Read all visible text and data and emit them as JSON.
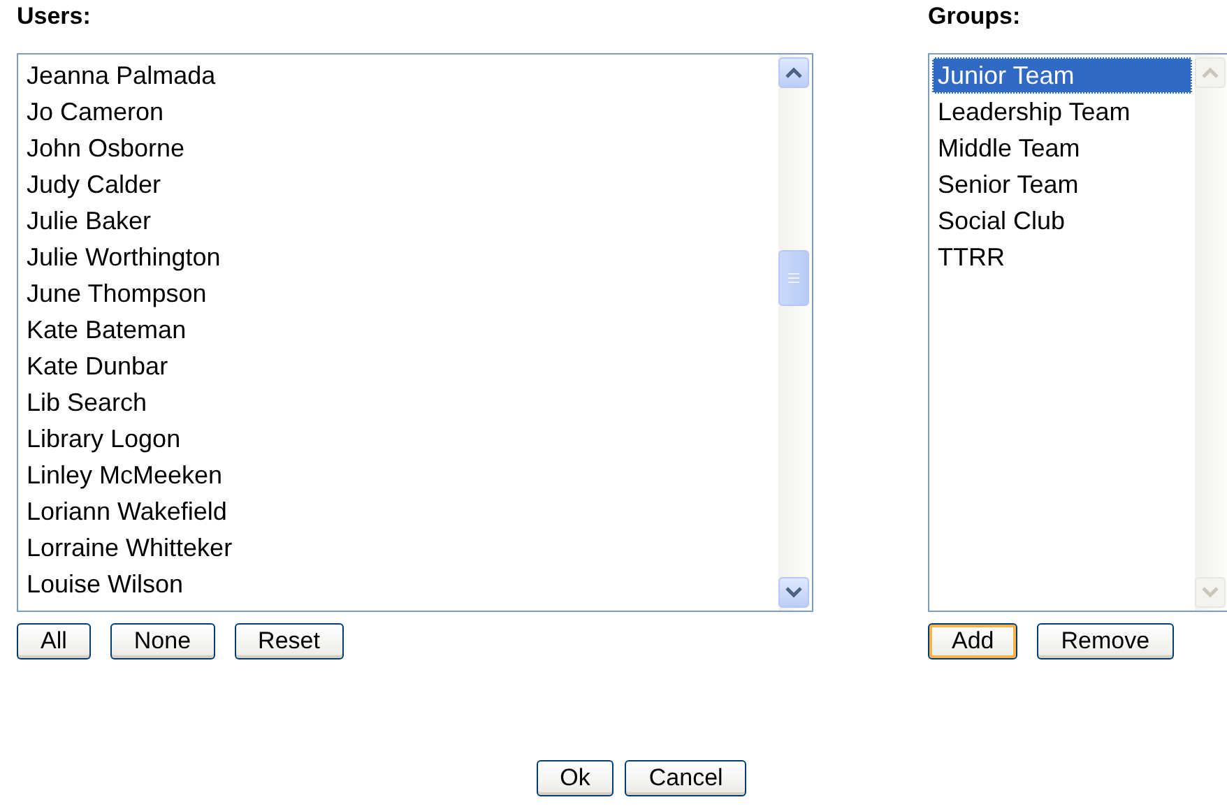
{
  "users": {
    "label": "Users:",
    "scrollbar_disabled": false,
    "items": [
      {
        "name": "Jeanna Palmada",
        "selected": false
      },
      {
        "name": "Jo Cameron",
        "selected": false
      },
      {
        "name": "John Osborne",
        "selected": false
      },
      {
        "name": "Judy Calder",
        "selected": false
      },
      {
        "name": "Julie Baker",
        "selected": false
      },
      {
        "name": "Julie Worthington",
        "selected": false
      },
      {
        "name": "June Thompson",
        "selected": false
      },
      {
        "name": "Kate Bateman",
        "selected": false
      },
      {
        "name": "Kate Dunbar",
        "selected": false
      },
      {
        "name": "Lib Search",
        "selected": false
      },
      {
        "name": "Library Logon",
        "selected": false
      },
      {
        "name": "Linley McMeeken",
        "selected": false
      },
      {
        "name": "Loriann Wakefield",
        "selected": false
      },
      {
        "name": "Lorraine Whitteker",
        "selected": false
      },
      {
        "name": "Louise Wilson",
        "selected": false
      }
    ],
    "buttons": [
      {
        "label": "All",
        "focused": false
      },
      {
        "label": "None",
        "focused": false
      },
      {
        "label": "Reset",
        "focused": false
      }
    ]
  },
  "groups": {
    "label": "Groups:",
    "scrollbar_disabled": true,
    "items": [
      {
        "name": "Junior Team",
        "selected": true
      },
      {
        "name": "Leadership Team",
        "selected": false
      },
      {
        "name": "Middle Team",
        "selected": false
      },
      {
        "name": "Senior Team",
        "selected": false
      },
      {
        "name": "Social Club",
        "selected": false
      },
      {
        "name": "TTRR",
        "selected": false
      }
    ],
    "buttons": [
      {
        "label": "Add",
        "focused": true
      },
      {
        "label": "Remove",
        "focused": false
      }
    ]
  },
  "dialog_buttons": [
    {
      "label": "Ok",
      "focused": false
    },
    {
      "label": "Cancel",
      "focused": false
    }
  ]
}
